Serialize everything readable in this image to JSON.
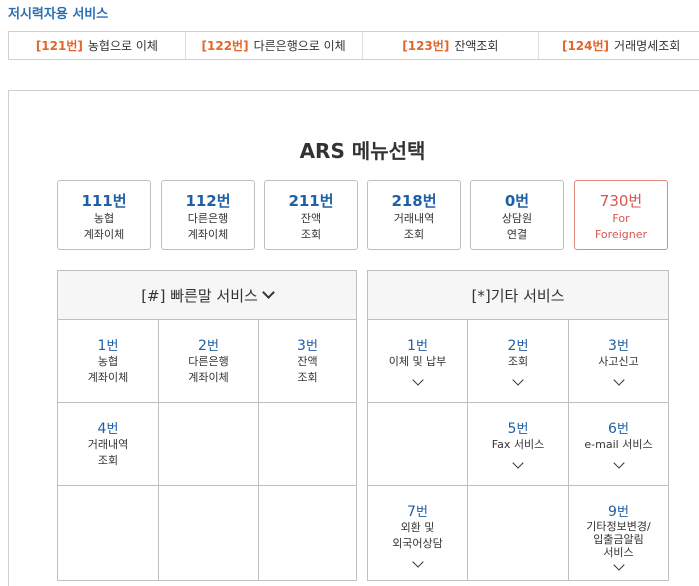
{
  "section_title": "저시력자용 서비스",
  "quick_items": [
    {
      "num": "[121번]",
      "label": "농협으로 이체"
    },
    {
      "num": "[122번]",
      "label": "다른은행으로 이체"
    },
    {
      "num": "[123번]",
      "label": "잔액조회"
    },
    {
      "num": "[124번]",
      "label": "거래명세조회"
    }
  ],
  "ars_title": "ARS 메뉴선택",
  "menu": [
    {
      "code": "111번",
      "line1": "농협",
      "line2": "계좌이체"
    },
    {
      "code": "112번",
      "line1": "다른은행",
      "line2": "계좌이체"
    },
    {
      "code": "211번",
      "line1": "잔액",
      "line2": "조회"
    },
    {
      "code": "218번",
      "line1": "거래내역",
      "line2": "조회"
    },
    {
      "code": "0번",
      "line1": "상담원",
      "line2": "연결"
    },
    {
      "code": "730번",
      "line1": "For",
      "line2": "Foreigner"
    }
  ],
  "quick_service": {
    "header": "[#] 빠른말 서비스",
    "items": [
      {
        "num": "1",
        "unit": "번",
        "line1": "농협",
        "line2": "계좌이체"
      },
      {
        "num": "2",
        "unit": "번",
        "line1": "다른은행",
        "line2": "계좌이체"
      },
      {
        "num": "3",
        "unit": "번",
        "line1": "잔액",
        "line2": "조회"
      },
      {
        "num": "4",
        "unit": "번",
        "line1": "거래내역",
        "line2": "조회"
      }
    ]
  },
  "other_service": {
    "header": "[*]기타 서비스",
    "items": [
      {
        "num": "1",
        "unit": "번",
        "line1": "이체 및 납부"
      },
      {
        "num": "2",
        "unit": "번",
        "line1": "조회"
      },
      {
        "num": "3",
        "unit": "번",
        "line1": "사고신고"
      },
      {
        "num": "5",
        "unit": "번",
        "line1": "Fax 서비스"
      },
      {
        "num": "6",
        "unit": "번",
        "line1": "e-mail 서비스"
      },
      {
        "num": "7",
        "unit": "번",
        "line1": "외환 및",
        "line2": "외국어상담"
      },
      {
        "num": "9",
        "unit": "번",
        "line1": "기타정보변경/",
        "line2": "입출금알림",
        "line3": "서비스"
      }
    ]
  },
  "colors": {
    "accent_blue": "#1f5fa6",
    "accent_orange": "#e2662b",
    "foreigner_red": "#d9534f"
  }
}
